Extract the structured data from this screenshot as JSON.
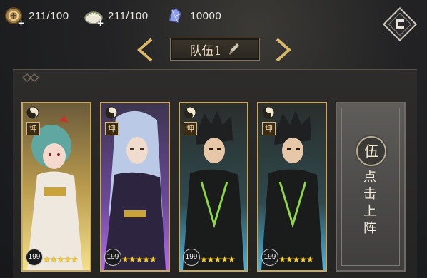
{
  "resources": [
    {
      "icon": "stamina-coin-icon",
      "value": "211/100"
    },
    {
      "icon": "dumpling-icon",
      "value": "211/100"
    },
    {
      "icon": "crystal-icon",
      "value": "10000"
    }
  ],
  "team": {
    "label": "队伍1",
    "edit_icon": "brush-edit-icon",
    "prev_icon": "chevron-left-icon",
    "next_icon": "chevron-right-icon"
  },
  "menu_icon": "diamond-menu-icon",
  "cards": [
    {
      "element_tag": "坤",
      "level": "199",
      "stars": "★★★★★",
      "palette": "gold"
    },
    {
      "element_tag": "坤",
      "level": "199",
      "stars": "★★★★★",
      "palette": "purple"
    },
    {
      "element_tag": "坤",
      "level": "199",
      "stars": "★★★★★",
      "palette": "blue"
    },
    {
      "element_tag": "坤",
      "level": "199",
      "stars": "★★★★★",
      "palette": "blue"
    }
  ],
  "empty_slot": {
    "seal": "伍",
    "call_to_action": "点击上阵"
  },
  "colors": {
    "gold_border": "#c9a760",
    "star": "#f5cf3b",
    "panel": "#2d2c2a"
  }
}
